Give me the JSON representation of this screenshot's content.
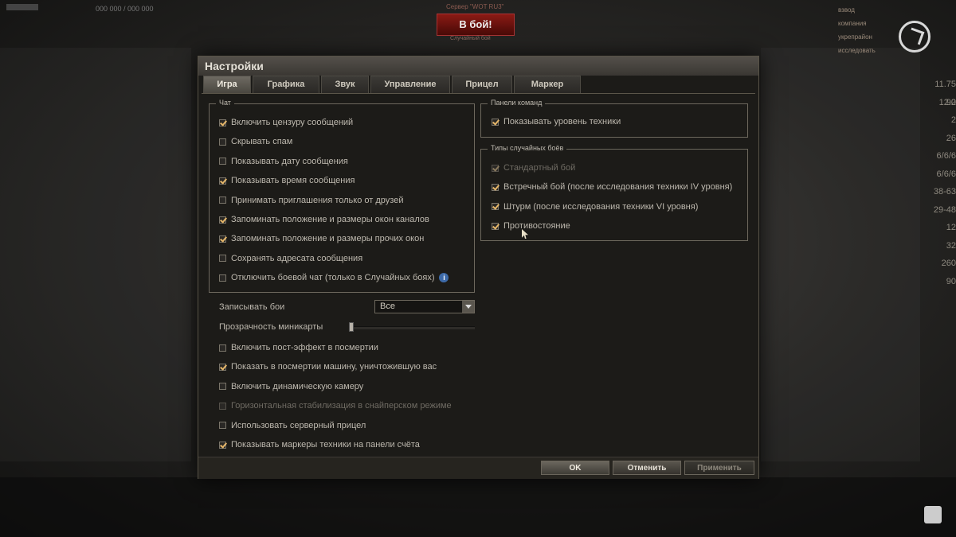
{
  "background": {
    "server_label": "Сервер \"WOT RU3\"",
    "battle_button": "В бой!",
    "battle_mode": "Случайный бой",
    "top_left_info": "000 000 / 000 000",
    "right_numbers": [
      "11.75 12.2",
      "90",
      "2",
      "26",
      "6/6/6",
      "6/6/6",
      "38-63",
      "29-48",
      "12",
      "32",
      "260",
      "90"
    ],
    "top_list": [
      "взвод",
      "компания",
      "укрепрайон",
      "исследовать"
    ]
  },
  "dialog": {
    "title": "Настройки",
    "tabs": [
      {
        "label": "Игра"
      },
      {
        "label": "Графика"
      },
      {
        "label": "Звук"
      },
      {
        "label": "Управление"
      },
      {
        "label": "Прицел"
      },
      {
        "label": "Маркер"
      }
    ],
    "chat": {
      "title": "Чат",
      "items": [
        {
          "label": "Включить цензуру сообщений",
          "checked": true
        },
        {
          "label": "Скрывать спам",
          "checked": false
        },
        {
          "label": "Показывать дату сообщения",
          "checked": false
        },
        {
          "label": "Показывать время сообщения",
          "checked": true
        },
        {
          "label": "Принимать приглашения только от друзей",
          "checked": false
        },
        {
          "label": "Запоминать положение и размеры окон каналов",
          "checked": true
        },
        {
          "label": "Запоминать положение и размеры прочих окон",
          "checked": true
        },
        {
          "label": "Сохранять адресата сообщения",
          "checked": false
        },
        {
          "label": "Отключить боевой чат (только в Случайных боях)",
          "checked": false
        }
      ]
    },
    "record": {
      "label": "Записывать бои",
      "value": "Все"
    },
    "minimap": {
      "label": "Прозрачность миникарты",
      "value": 0
    },
    "other_items": [
      {
        "label": "Включить пост-эффект в посмертии",
        "checked": false,
        "disabled": false
      },
      {
        "label": "Показать в посмертии машину, уничтожившую вас",
        "checked": true,
        "disabled": false
      },
      {
        "label": "Включить динамическую камеру",
        "checked": false,
        "disabled": false
      },
      {
        "label": "Горизонтальная стабилизация в снайперском режиме",
        "checked": false,
        "disabled": true
      },
      {
        "label": "Использовать серверный прицел",
        "checked": false,
        "disabled": false
      },
      {
        "label": "Показывать маркеры техники на панели счёта",
        "checked": true,
        "disabled": false
      }
    ],
    "team_panel": {
      "title": "Панели команд",
      "items": [
        {
          "label": "Показывать уровень техники",
          "checked": true
        }
      ]
    },
    "battle_types": {
      "title": "Типы случайных боёв",
      "items": [
        {
          "label": "Стандартный бой",
          "checked": true,
          "disabled": true
        },
        {
          "label": "Встречный бой (после исследования техники IV уровня)",
          "checked": true,
          "disabled": false
        },
        {
          "label": "Штурм (после исследования техники VI уровня)",
          "checked": true,
          "disabled": false
        },
        {
          "label": "Противостояние",
          "checked": true,
          "disabled": false
        }
      ]
    },
    "buttons": {
      "ok": "OK",
      "cancel": "Отменить",
      "apply": "Применить"
    }
  }
}
